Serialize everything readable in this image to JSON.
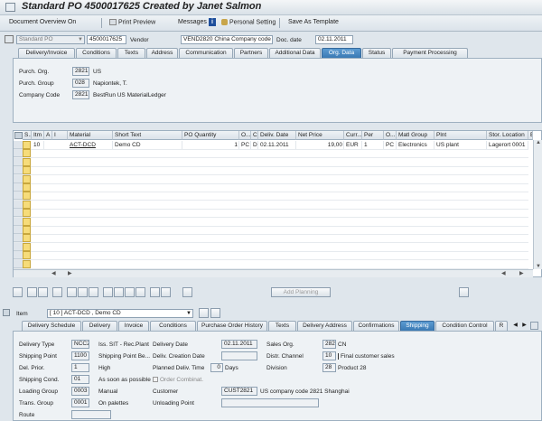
{
  "window": {
    "title": "Standard PO 4500017625 Created by Janet Salmon"
  },
  "toolbar": {
    "document_overview": "Document Overview On",
    "print_preview": "Print Preview",
    "messages": "Messages",
    "personal_setting": "Personal Setting",
    "save_as_template": "Save As Template"
  },
  "header": {
    "doc_type": "Standard PO",
    "po_number": "4500017625",
    "vendor_label": "Vendor",
    "vendor_value": "VEND2820 China Company code ...",
    "doc_date_label": "Doc. date",
    "doc_date_value": "02.11.2011"
  },
  "header_tabs": [
    "Delivery/Invoice",
    "Conditions",
    "Texts",
    "Address",
    "Communication",
    "Partners",
    "Additional Data",
    "Org. Data",
    "Status",
    "Payment Processing"
  ],
  "org_data": {
    "purch_org_label": "Purch. Org.",
    "purch_org_value": "2821",
    "purch_org_desc": "US",
    "purch_group_label": "Purch. Group",
    "purch_group_value": "028",
    "purch_group_desc": "Napiontek, T.",
    "company_code_label": "Company Code",
    "company_code_value": "2821",
    "company_code_desc": "BestRun US MaterialLedger"
  },
  "item_table": {
    "columns": [
      "S..",
      "Itm",
      "A",
      "I",
      "Material",
      "Short Text",
      "PO Quantity",
      "O...",
      "C",
      "Deliv. Date",
      "Net Price",
      "Curr...",
      "Per",
      "O...",
      "Matl Group",
      "Plnt",
      "Stor. Location",
      "B"
    ],
    "rows": [
      [
        "",
        "10",
        "",
        "",
        "ACT-DCD",
        "Demo CD",
        "1",
        "PC",
        "D",
        "02.11.2011",
        "19,00",
        "EUR",
        "1",
        "PC",
        "Electronics",
        "US plant",
        "Lagerort 0001",
        ""
      ]
    ]
  },
  "table_buttons": {
    "add_planning": "Add Planning"
  },
  "item_selector": {
    "label": "Item",
    "value": "[ 10 ] ACT-DCD , Demo CD"
  },
  "item_tabs": [
    "Delivery Schedule",
    "Delivery",
    "Invoice",
    "Conditions",
    "Purchase Order History",
    "Texts",
    "Delivery Address",
    "Confirmations",
    "Shipping",
    "Condition Control",
    "R"
  ],
  "shipping": {
    "delivery_type_label": "Delivery Type",
    "delivery_type_value": "NCC2",
    "iss_sit_label": "Iss. SIT - Rec.Plant",
    "delivery_date_label": "Delivery Date",
    "delivery_date_value": "02.11.2011",
    "sales_org_label": "Sales Org.",
    "sales_org_value": "2820",
    "sales_org_desc": "CN",
    "shipping_point_label": "Shipping Point",
    "shipping_point_value": "1100",
    "shipping_point_be_label": "Shipping Point Be...",
    "deliv_creation_label": "Deliv. Creation Date",
    "distr_channel_label": "Distr. Channel",
    "distr_channel_value": "10",
    "distr_channel_desc": "Final customer sales",
    "del_prior_label": "Del. Prior.",
    "del_prior_value": "1",
    "del_prior_desc": "High",
    "planned_deliv_label": "Planned Deliv. Time",
    "planned_deliv_value": "0",
    "planned_deliv_unit": "Days",
    "division_label": "Division",
    "division_value": "28",
    "division_desc": "Product 28",
    "shipping_cond_label": "Shipping Cond.",
    "shipping_cond_value": "01",
    "shipping_cond_desc": "As soon as possible",
    "order_combinat_label": "Order Combinat.",
    "loading_group_label": "Loading Group",
    "loading_group_value": "0003",
    "loading_group_desc": "Manual",
    "customer_label": "Customer",
    "customer_value": "CUST2821",
    "customer_desc": "US company code 2821 Shanghai",
    "trans_group_label": "Trans. Group",
    "trans_group_value": "0001",
    "trans_group_desc": "On palettes",
    "unloading_point_label": "Unloading Point",
    "route_label": "Route"
  },
  "colors": {
    "active_tab": "#3a79b3",
    "cell_highlight": "#f6dc7a",
    "background": "#dfe6ec"
  }
}
